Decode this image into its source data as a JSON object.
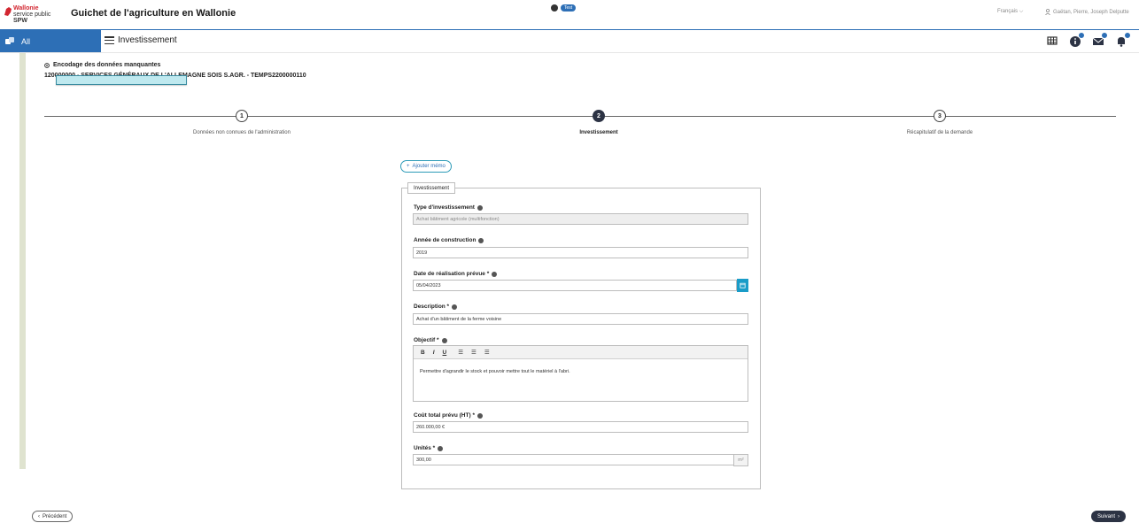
{
  "header": {
    "logo_line1": "Wallonie",
    "logo_line2": "service public",
    "logo_line3": "SPW",
    "app_title": "Guichet de l'agriculture en Wallonie",
    "env_badge": "Test",
    "language": "Français",
    "user_name": "Gaëtan, Pierre, Joseph Delputte"
  },
  "nav": {
    "all_label": "All",
    "module_label": "Investissement"
  },
  "page": {
    "title": "Encodage des données manquantes",
    "dossier": "120000000 - SERVICES GÉNÉRAUX DE L'ALLEMAGNE SOIS S.AGR. - TEMPS2200000110"
  },
  "stepper": {
    "steps": [
      {
        "number": "1",
        "label": "Données non connues de l'administration"
      },
      {
        "number": "2",
        "label": "Investissement"
      },
      {
        "number": "3",
        "label": "Récapitulatif de la demande"
      }
    ],
    "active_step": 2
  },
  "memo_button": "Ajouter mémo",
  "form": {
    "legend": "Investissement",
    "type": {
      "label": "Type d'investissement",
      "value": "Achat bâtiment agricole (multifonction)"
    },
    "annee": {
      "label": "Année de construction",
      "value": "2019"
    },
    "date": {
      "label": "Date de réalisation prévue *",
      "value": "05/04/2023"
    },
    "description": {
      "label": "Description *",
      "value": "Achat d'un bâtiment de la ferme voisine"
    },
    "objectif": {
      "label": "Objectif *",
      "toolbar": [
        "B",
        "I",
        "U",
        "☰",
        "☰",
        "☰"
      ],
      "value": "Permettre d'agrandir le stock et pouvoir mettre tout le matériel à l'abri."
    },
    "cout": {
      "label": "Coût total prévu (HT) *",
      "value": "260.000,00 €"
    },
    "unites": {
      "label": "Unités *",
      "value": "300,00",
      "unit": "m²"
    }
  },
  "footer": {
    "prev": "Précédent",
    "next": "Suivant"
  },
  "colors": {
    "accent": "#2d6fb6",
    "stepper_active": "#2c3344",
    "calendar": "#1a9cc8"
  }
}
